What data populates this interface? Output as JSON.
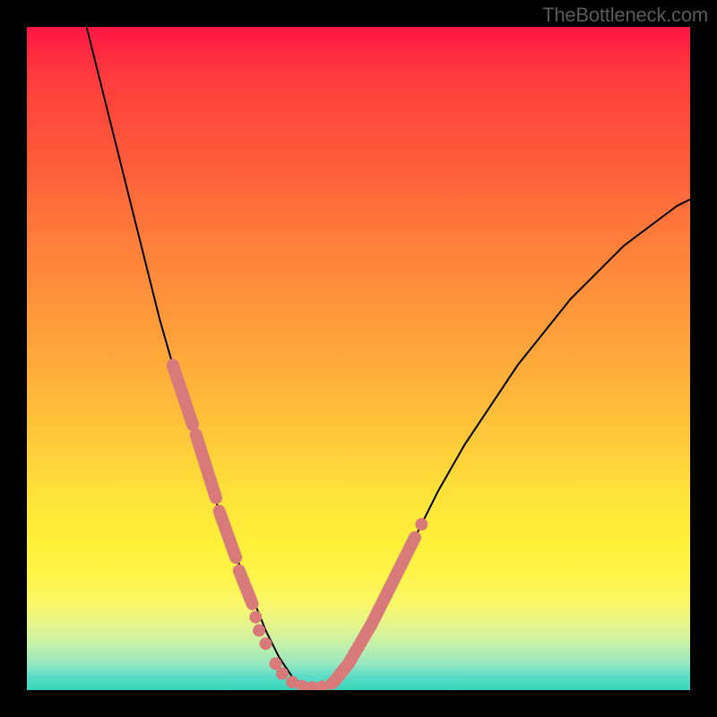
{
  "watermark": "TheBottleneck.com",
  "chart_data": {
    "type": "line",
    "title": "",
    "xlabel": "",
    "ylabel": "",
    "xlim": [
      0,
      100
    ],
    "ylim": [
      0,
      100
    ],
    "grid": false,
    "curve_notes": "V-shaped curve: left branch descends steeply from top-left to a flat minimum near x≈38-46 at y≈0, right branch rises more gradually toward upper-right.",
    "series": [
      {
        "name": "curve",
        "x": [
          9,
          10,
          12,
          14,
          16,
          18,
          20,
          22,
          24,
          26,
          28,
          30,
          32,
          34,
          36,
          38,
          40,
          42,
          44,
          46,
          48,
          50,
          52,
          54,
          56,
          58,
          62,
          66,
          70,
          74,
          78,
          82,
          86,
          90,
          94,
          98,
          100
        ],
        "values": [
          100,
          96,
          88,
          80,
          72,
          64,
          56,
          49,
          42,
          36,
          30,
          24,
          19,
          14,
          9,
          5,
          2,
          0.5,
          0.3,
          1,
          3,
          6,
          10,
          14,
          18,
          22,
          30,
          37,
          43,
          49,
          54,
          59,
          63,
          67,
          70,
          73,
          74
        ]
      }
    ],
    "highlight_segments": [
      {
        "x": [
          22,
          25
        ],
        "y": [
          49,
          40
        ]
      },
      {
        "x": [
          25.5,
          28.5
        ],
        "y": [
          38.5,
          29
        ]
      },
      {
        "x": [
          29,
          31.5
        ],
        "y": [
          27,
          20
        ]
      },
      {
        "x": [
          32,
          34
        ],
        "y": [
          18,
          13
        ]
      },
      {
        "x": [
          46.5,
          48.5
        ],
        "y": [
          1.5,
          4
        ]
      },
      {
        "x": [
          48.5,
          52
        ],
        "y": [
          4,
          10
        ]
      },
      {
        "x": [
          52,
          55.5
        ],
        "y": [
          10,
          17
        ]
      },
      {
        "x": [
          55.5,
          58.5
        ],
        "y": [
          17,
          23
        ]
      }
    ],
    "highlight_dots": [
      {
        "x": 34.5,
        "y": 11
      },
      {
        "x": 35,
        "y": 9
      },
      {
        "x": 36,
        "y": 7
      },
      {
        "x": 37.5,
        "y": 4
      },
      {
        "x": 38.5,
        "y": 2.5
      },
      {
        "x": 40,
        "y": 1.2
      },
      {
        "x": 41.5,
        "y": 0.6
      },
      {
        "x": 43,
        "y": 0.4
      },
      {
        "x": 44.5,
        "y": 0.5
      },
      {
        "x": 46,
        "y": 1
      },
      {
        "x": 58.5,
        "y": 23
      },
      {
        "x": 59.5,
        "y": 25
      }
    ]
  }
}
